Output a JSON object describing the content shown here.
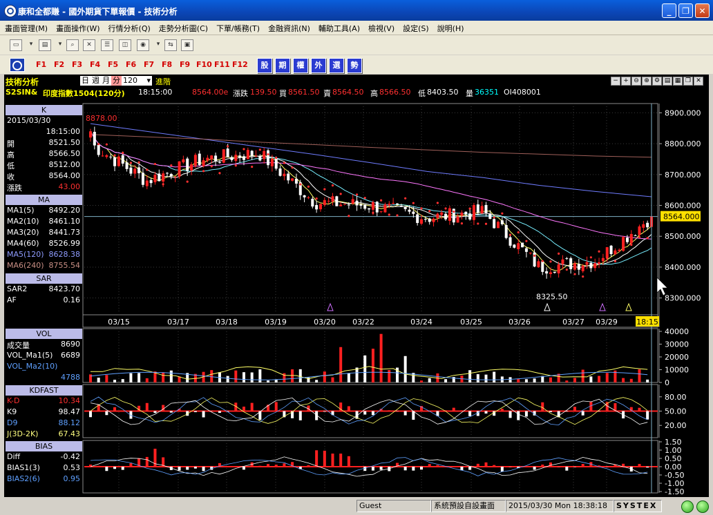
{
  "window": {
    "title": "康和全都賺 - 國外期貨下單報價 - 技術分析"
  },
  "menu": [
    "畫面管理(M)",
    "畫面操作(W)",
    "行情分析(Q)",
    "走勢分析圖(C)",
    "下單/帳務(T)",
    "金融資訊(N)",
    "輔助工具(A)",
    "檢視(V)",
    "設定(S)",
    "說明(H)"
  ],
  "fkeys": [
    "F1",
    "F2",
    "F3",
    "F4",
    "F5",
    "F6",
    "F7",
    "F8",
    "F9",
    "F10",
    "F11",
    "F12"
  ],
  "category_buttons": [
    "股",
    "期",
    "權",
    "外",
    "選",
    "勢"
  ],
  "chart_header": {
    "panel_name": "技術分析",
    "periods": [
      "日",
      "週",
      "月",
      "分"
    ],
    "selected_period": "分",
    "interval_value": "120",
    "advanced_label": "進階",
    "symbol": "S2SIN&",
    "instrument": "印度指數1504(120分)",
    "time": "18:15:00",
    "last_price": "8564.00e",
    "change_label": "漲跌",
    "change": "139.50",
    "bid_label": "買",
    "bid": "8561.50",
    "ask_label": "賣",
    "ask": "8564.50",
    "high_label": "高",
    "high": "8566.50",
    "low_label": "低",
    "low": "8403.50",
    "volume_label": "量",
    "volume": "36351",
    "oi": "OI408001"
  },
  "k_panel": {
    "title": "K",
    "date": "2015/03/30",
    "time": "18:15:00",
    "rows": [
      {
        "label": "開",
        "value": "8521.50"
      },
      {
        "label": "高",
        "value": "8566.50"
      },
      {
        "label": "低",
        "value": "8512.00"
      },
      {
        "label": "收",
        "value": "8564.00"
      }
    ],
    "change_label": "漲跌",
    "change_value": "43.00"
  },
  "ma_panel": {
    "title": "MA",
    "rows": [
      {
        "label": "MA1(5)",
        "value": "8492.20",
        "color": "#ffffff"
      },
      {
        "label": "MA2(10)",
        "value": "8461.10",
        "color": "#ffffff"
      },
      {
        "label": "MA3(20)",
        "value": "8441.73",
        "color": "#ffffff"
      },
      {
        "label": "MA4(60)",
        "value": "8526.99",
        "color": "#ffffff"
      },
      {
        "label": "MA5(120)",
        "value": "8628.38",
        "color": "#8f9cff"
      },
      {
        "label": "MA6(240)",
        "value": "8755.54",
        "color": "#c98f85"
      }
    ]
  },
  "sar_panel": {
    "title": "SAR",
    "rows": [
      {
        "label": "SAR2",
        "value": "8423.70"
      },
      {
        "label": "AF",
        "value": "0.16"
      }
    ]
  },
  "vol_panel": {
    "title": "VOL",
    "rows": [
      {
        "label": "成交量",
        "value": "8690"
      },
      {
        "label": "VOL_Ma1(5)",
        "value": "6689"
      },
      {
        "label": "VOL_Ma2(10)",
        "value": ""
      },
      {
        "label": "",
        "value": "4788"
      }
    ]
  },
  "kd_panel": {
    "title": "KDFAST",
    "rows": [
      {
        "label": "K-D",
        "value": "10.34"
      },
      {
        "label": "K9",
        "value": "98.47"
      },
      {
        "label": "D9",
        "value": "88.12"
      },
      {
        "label": "J(3D-2K)",
        "value": "67.43"
      }
    ]
  },
  "bias_panel": {
    "title": "BIAS",
    "rows": [
      {
        "label": "Diff",
        "value": "-0.42"
      },
      {
        "label": "BIAS1(3)",
        "value": "0.53"
      },
      {
        "label": "BIAS2(6)",
        "value": "0.95"
      }
    ]
  },
  "price_axis": {
    "ticks": [
      "8900.000",
      "8800.000",
      "8700.000",
      "8600.000",
      "8500.000",
      "8400.000",
      "8300.000"
    ],
    "current": "8564.000"
  },
  "vol_axis": [
    "40000",
    "30000",
    "20000",
    "10000",
    "0"
  ],
  "kd_axis": [
    "80.00",
    "50.00",
    "20.00"
  ],
  "bias_axis": [
    "1.50",
    "1.00",
    "0.50",
    "0.00",
    "-0.50",
    "-1.00",
    "-1.50"
  ],
  "date_labels": [
    "03/15",
    "03/17",
    "03/18",
    "03/19",
    "03/20",
    "03/22",
    "03/24",
    "03/25",
    "03/26",
    "03/27",
    "03/29"
  ],
  "cursor_time": "18:15",
  "annotations": {
    "high": "8878.00",
    "low": "8325.50"
  },
  "chart_data": {
    "type": "candlestick",
    "xlabel": "",
    "ylabel": "",
    "ylim": [
      8250,
      8930
    ],
    "x": [
      "03/15",
      "03/17",
      "03/18",
      "03/19",
      "03/20",
      "03/22",
      "03/24",
      "03/25",
      "03/26",
      "03/27",
      "03/29"
    ],
    "series": [
      {
        "name": "K",
        "values": [
          8800,
          8680,
          8750,
          8770,
          8610,
          8600,
          8560,
          8580,
          8400,
          8420,
          8564
        ]
      },
      {
        "name": "MA5(120)",
        "values": [
          8865,
          8840,
          8815,
          8790,
          8765,
          8738,
          8710,
          8690,
          8665,
          8645,
          8628
        ]
      },
      {
        "name": "MA6(240)",
        "values": [
          8830,
          8822,
          8815,
          8805,
          8797,
          8788,
          8780,
          8772,
          8766,
          8760,
          8756
        ]
      }
    ]
  },
  "status": {
    "user": "Guest",
    "screen": "系統預設自設畫面",
    "datetime": "2015/03/30 Mon 18:38:18",
    "brand": "SYSTEX"
  }
}
